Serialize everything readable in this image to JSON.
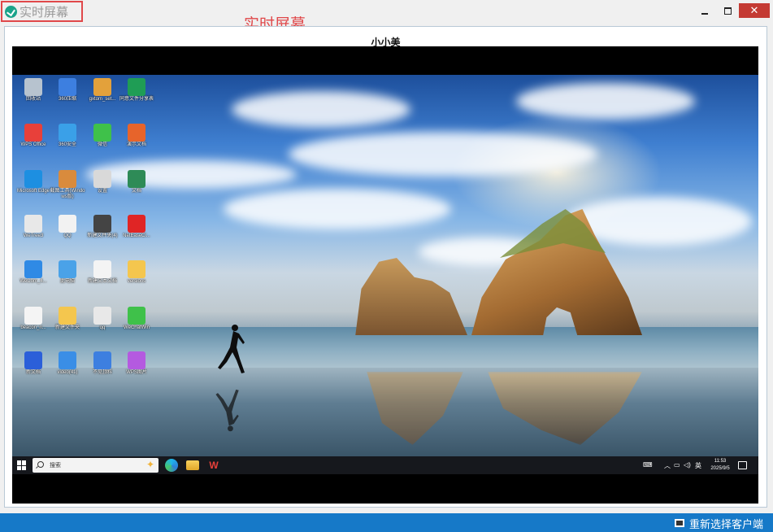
{
  "window": {
    "title": "实时屏幕",
    "annotation": "实时屏幕",
    "close_glyph": "✕"
  },
  "panel": {
    "client_name": "小小美"
  },
  "desktop": {
    "icons": [
      {
        "label": "回收站",
        "icon": "recycle-bin-icon",
        "color": "#b7c3cf"
      },
      {
        "label": "360压缩",
        "icon": "archive-icon",
        "color": "#3d7fe0"
      },
      {
        "label": "gxtom_set...",
        "icon": "settings-app-icon",
        "color": "#e3a13b"
      },
      {
        "label": "同意文件分享表",
        "icon": "spreadsheet-icon",
        "color": "#1f9d55"
      },
      {
        "label": "WPS Office",
        "icon": "wps-office-icon",
        "color": "#e8403a"
      },
      {
        "label": "360安全",
        "icon": "browser-icon",
        "color": "#3aa0e8"
      },
      {
        "label": "微信",
        "icon": "wechat-icon",
        "color": "#3fc14a"
      },
      {
        "label": "演示文档",
        "icon": "presentation-icon",
        "color": "#e7642b"
      },
      {
        "label": "Microsoft Edge",
        "icon": "edge-icon",
        "color": "#1d8fe1"
      },
      {
        "label": "截图工具(Windows版)",
        "icon": "snipping-tool-icon",
        "color": "#d98b3d"
      },
      {
        "label": "设置",
        "icon": "gear-icon",
        "color": "#d9d9d9"
      },
      {
        "label": "文档",
        "icon": "document-icon",
        "color": "#2e8b57"
      },
      {
        "label": "WeTree3",
        "icon": "file-icon",
        "color": "#e8e8e8"
      },
      {
        "label": "QQ",
        "icon": "qq-icon",
        "color": "#f2f2f2"
      },
      {
        "label": "新建文件夹(4)",
        "icon": "folder-image-icon",
        "color": "#444444"
      },
      {
        "label": "NetEaseCl...",
        "icon": "netease-music-icon",
        "color": "#e02525"
      },
      {
        "label": "WeCom_4...",
        "icon": "wecom-icon",
        "color": "#2f8ae5"
      },
      {
        "label": "此电脑",
        "icon": "computer-icon",
        "color": "#4aa2e8"
      },
      {
        "label": "新建文本文档",
        "icon": "text-file-icon",
        "color": "#f4f4f4"
      },
      {
        "label": "versions",
        "icon": "folder-icon",
        "color": "#f4c64e"
      },
      {
        "label": "beacon_n...",
        "icon": "text-file-icon",
        "color": "#f4f4f4"
      },
      {
        "label": "新建文件夹",
        "icon": "folder-icon",
        "color": "#f4c64e"
      },
      {
        "label": "qq",
        "icon": "qq-shortcut-icon",
        "color": "#e8e8e8"
      },
      {
        "label": "WeChatWin",
        "icon": "wechat-setup-icon",
        "color": "#3fc14a"
      },
      {
        "label": "新文档",
        "icon": "word-doc-icon",
        "color": "#2b5fd9"
      },
      {
        "label": "video(41)",
        "icon": "video-file-icon",
        "color": "#3a8ee6"
      },
      {
        "label": "不见顶料",
        "icon": "archive-icon",
        "color": "#3d7fe0"
      },
      {
        "label": "WPS图片",
        "icon": "wps-photo-icon",
        "color": "#b45ae0"
      }
    ]
  },
  "taskbar": {
    "search_placeholder": "搜索",
    "tray_lang": "英",
    "time": "11:53",
    "date": "2025/9/5"
  },
  "status": {
    "reselect_label": "重新选择客户端"
  }
}
